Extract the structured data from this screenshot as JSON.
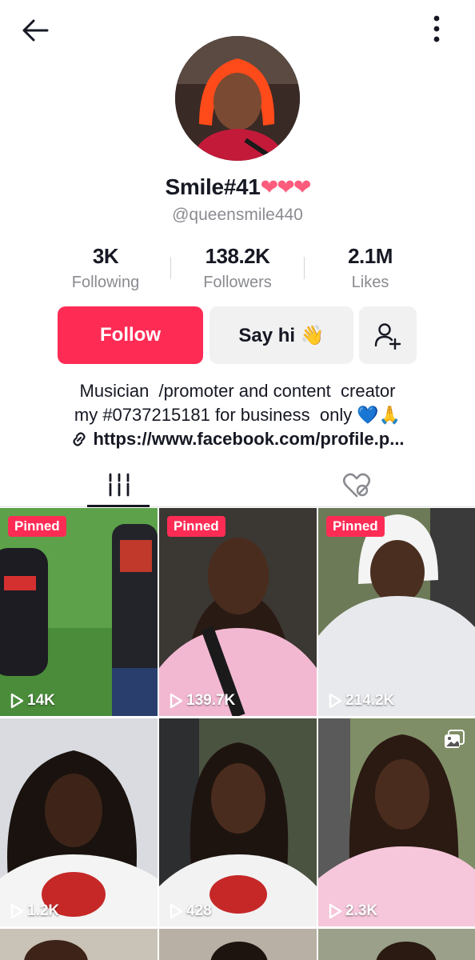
{
  "profile": {
    "display_name": "Smile#41",
    "hearts": "❤❤❤",
    "username": "@queensmile440"
  },
  "stats": [
    {
      "value": "3K",
      "label": "Following"
    },
    {
      "value": "138.2K",
      "label": "Followers"
    },
    {
      "value": "2.1M",
      "label": "Likes"
    }
  ],
  "actions": {
    "follow_label": "Follow",
    "sayhi_label": "Say hi 👋"
  },
  "bio": {
    "line1": "Musician  /promoter and content  creator",
    "line2": "my #0737215181 for business  only 💙🙏",
    "link": "https://www.facebook.com/profile.p..."
  },
  "tabs": [
    {
      "name": "videos",
      "icon": "grid-lines-icon",
      "active": true
    },
    {
      "name": "liked",
      "icon": "heart-hidden-icon",
      "active": false
    }
  ],
  "videos": [
    {
      "pinned_label": "Pinned",
      "views": "14K"
    },
    {
      "pinned_label": "Pinned",
      "views": "139.7K"
    },
    {
      "pinned_label": "Pinned",
      "views": "214.2K"
    },
    {
      "views": "1.2K"
    },
    {
      "views": "428"
    },
    {
      "views": "2.3K",
      "badge": "photo-icon"
    }
  ],
  "colors": {
    "accent": "#fe2c55",
    "hearts": "#fe5c7c",
    "muted_text": "#8a8b91",
    "secondary_button": "#f1f1f2"
  }
}
